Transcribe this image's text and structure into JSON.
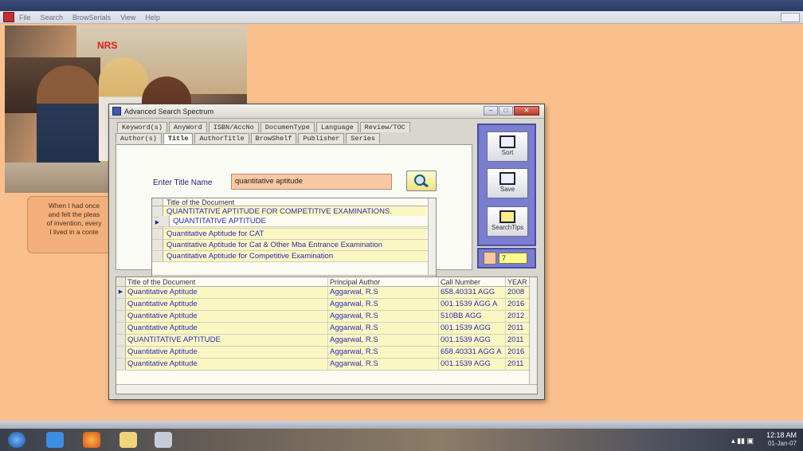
{
  "menubar": {
    "items": [
      "File",
      "Search",
      "BrowSerials",
      "View",
      "Help"
    ]
  },
  "banner": {
    "logo_text": "NRS",
    "caption_lines": [
      "When I had once",
      "and felt the pleas",
      "of invention, every",
      "I lived in a conte"
    ]
  },
  "dialog": {
    "title": "Advanced Search Spectrum",
    "tabs_row1": [
      "Keyword(s)",
      "AnyWord",
      "ISBN/AccNo",
      "DocumenType",
      "Language",
      "Review/TOC"
    ],
    "tabs_row2": [
      "Author(s)",
      "Title",
      "AuthorTitle",
      "BrowShelf",
      "Publisher",
      "Series"
    ],
    "active_tab": "Title",
    "title_field": {
      "label": "Enter Title Name",
      "value": "quantitative aptitude"
    },
    "title_list": {
      "header": "Title of the Document",
      "rows": [
        "QUANTITATIVE APTITUDE",
        "QUANTITATIVE APTITUDE FOR COMPETITIVE EXAMINATIONS.",
        "Quantitative Aptitude",
        "Quantitative Aptitude for CAT",
        "Quantitative Aptitude for Cat & Other Mba Entrance Examination",
        "Quantitative Aptitude for Competitive Examination"
      ],
      "selected_index": 2
    },
    "side_buttons": {
      "sort": "Sort",
      "save": "Save",
      "search_tips": "SearchTips"
    },
    "result_count": "7",
    "results": {
      "columns": [
        "Title of the Document",
        "Principal Author",
        "Call Number",
        "YEAR"
      ],
      "rows": [
        [
          "Quantitative Aptitude",
          "Aggarwal, R.S",
          "658.40331     AGG",
          "2008"
        ],
        [
          "Quantitative Aptitude",
          "Aggarwal, R.S",
          "001.1539 AGG  A",
          "2016"
        ],
        [
          "Quantitative Aptitude",
          "Aggarwal, R.S",
          "510BB      AGG",
          "2012"
        ],
        [
          "Quantitative Aptitude",
          "Aggarwal, R.S",
          "001.1539      AGG",
          "2011"
        ],
        [
          "QUANTITATIVE APTITUDE",
          "Aggarwal, R.S",
          "001.1539      AGG",
          "2011"
        ],
        [
          "Quantitative Aptitude",
          "Aggarwal, R.S",
          "658.40331 AGG  A",
          "2016"
        ],
        [
          "Quantitative Aptitude",
          "Aggarwal, R.S",
          "001.1539      AGG",
          "2011"
        ]
      ],
      "selected_index": 0
    }
  },
  "taskbar": {
    "time": "12:18 AM",
    "date": "01-Jan-07"
  }
}
